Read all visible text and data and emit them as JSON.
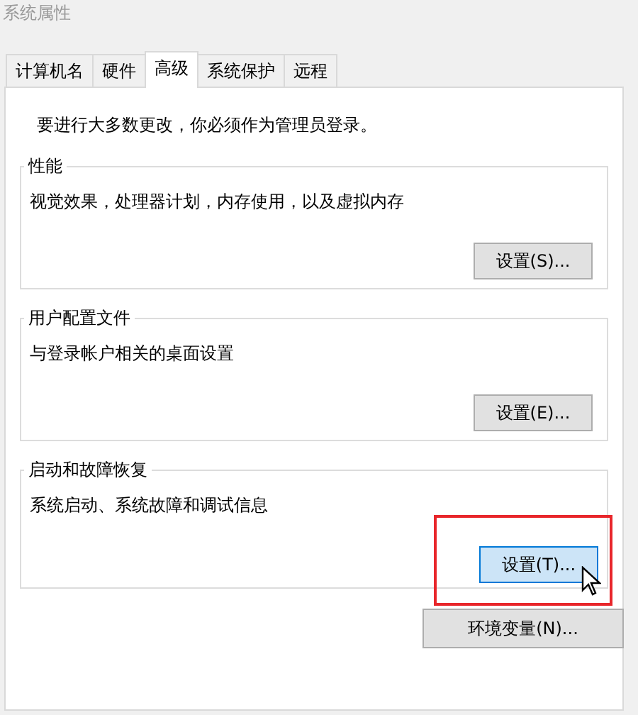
{
  "window": {
    "title": "系统属性"
  },
  "tabs": [
    {
      "label": "计算机名",
      "selected": false
    },
    {
      "label": "硬件",
      "selected": false
    },
    {
      "label": "高级",
      "selected": true
    },
    {
      "label": "系统保护",
      "selected": false
    },
    {
      "label": "远程",
      "selected": false
    }
  ],
  "notice": "要进行大多数更改，你必须作为管理员登录。",
  "groups": [
    {
      "title": "性能",
      "description": "视觉效果，处理器计划，内存使用，以及虚拟内存",
      "button": {
        "label": "设置(S)...",
        "hovered": false,
        "highlighted": false
      }
    },
    {
      "title": "用户配置文件",
      "description": "与登录帐户相关的桌面设置",
      "button": {
        "label": "设置(E)...",
        "hovered": false,
        "highlighted": false
      }
    },
    {
      "title": "启动和故障恢复",
      "description": "系统启动、系统故障和调试信息",
      "button": {
        "label": "设置(T)...",
        "hovered": true,
        "highlighted": true
      }
    }
  ],
  "bottom_button": {
    "label": "环境变量(N)..."
  }
}
